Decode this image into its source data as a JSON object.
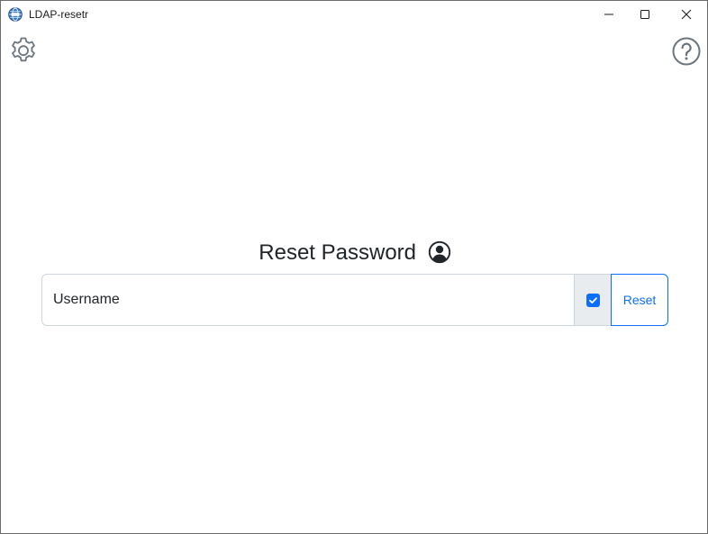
{
  "window": {
    "title": "LDAP-resetr"
  },
  "toolbar": {
    "settings_icon": "gear-icon",
    "help_icon": "help-circle-icon"
  },
  "main": {
    "heading": "Reset Password",
    "heading_icon": "user-circle-icon",
    "username": {
      "placeholder": "Username",
      "value": ""
    },
    "option_checked": true,
    "reset_label": "Reset"
  },
  "colors": {
    "accent": "#0d6efd",
    "addon_bg": "#e9ecef",
    "border": "#ced4da",
    "text": "#212529"
  }
}
